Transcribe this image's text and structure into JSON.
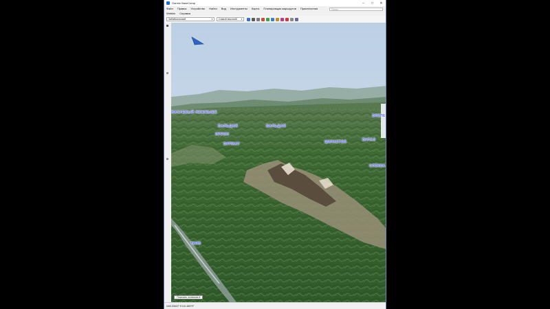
{
  "window": {
    "title": "Garmin BaseCamp",
    "controls": {
      "minimize": "–",
      "maximize": "□",
      "close": "✕"
    }
  },
  "menu": {
    "row1": [
      "Файл",
      "Правка",
      "Устройство",
      "Найти",
      "Вид",
      "Инструменты",
      "Карты",
      "Планировщик маршрутов",
      "Приключения"
    ],
    "row2": [
      "Weblnk",
      "Справка"
    ],
    "search_placeholder": "Поиск"
  },
  "toolbar": {
    "map_select": "Забайкальский",
    "detail_select": "Самый высокий",
    "icons": [
      "select-icon",
      "pan-icon",
      "zoom-icon",
      "measure-icon",
      "waypoint-icon",
      "track-icon",
      "route-icon",
      "find-icon",
      "globe-icon",
      "dash-icon",
      "settings-icon"
    ]
  },
  "map": {
    "labels": [
      "ВАСУЕВЫЙ ЛЕЖЖЫЕЕ",
      "БАЛЬДАЯ",
      "БАЛЬДАЯ",
      "ИРРИН",
      "БУРМАТ",
      "ЦИЛАЕТЕЯ",
      "БУЛАЗ",
      "ТКИВ",
      "СЛЕКВА",
      "ЭЛЕЛЕ"
    ],
    "show_button": "Показать названия"
  },
  "status": {
    "coordinates": "N48.30622° E110.48579°"
  }
}
